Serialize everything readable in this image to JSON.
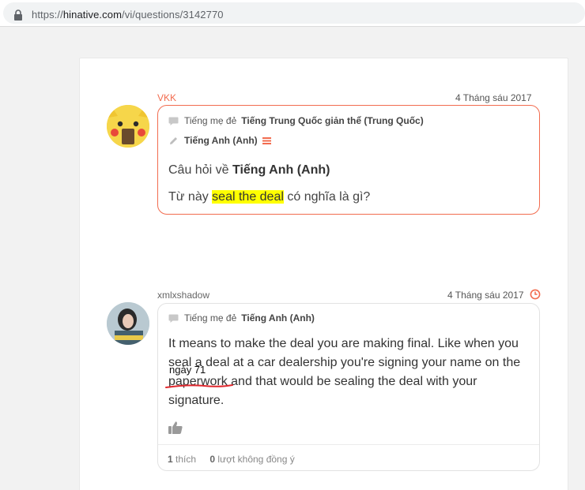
{
  "browser": {
    "url_prefix": "https://",
    "url_host": "hinative.com",
    "url_path": "/vi/questions/3142770"
  },
  "question": {
    "username": "VKK",
    "date": "4 Tháng sáu 2017",
    "native_label": "Tiếng mẹ đẻ",
    "native_language": "Tiếng Trung Quốc giản thể (Trung Quốc)",
    "learning_language": "Tiếng Anh (Anh)",
    "about_label": "Câu hỏi về",
    "about_language": "Tiếng Anh (Anh)",
    "text_before": "Từ này ",
    "highlight": "seal the deal",
    "text_after": " có nghĩa là gì?"
  },
  "answer": {
    "username": "xmlxshadow",
    "date": "4 Tháng sáu 2017",
    "native_label": "Tiếng mẹ đẻ",
    "native_language": "Tiếng Anh (Anh)",
    "text": "It means to make the deal you are making final. Like when you seal a deal at a car dealership you're signing your name on the paperwork and that would be sealing the deal with your signature.",
    "annotation": "ngày 71",
    "likes_count": "1",
    "likes_label": "thích",
    "disagree_count": "0",
    "disagree_label": "lượt không đồng ý"
  },
  "colors": {
    "accent": "#f26c4f",
    "highlight": "#ffff00",
    "annotation_red": "#e0282e"
  },
  "icons": [
    "lock-icon",
    "speech-bubble-icon",
    "pencil-icon",
    "level-bars-icon",
    "clock-icon",
    "thumbs-up-icon"
  ]
}
